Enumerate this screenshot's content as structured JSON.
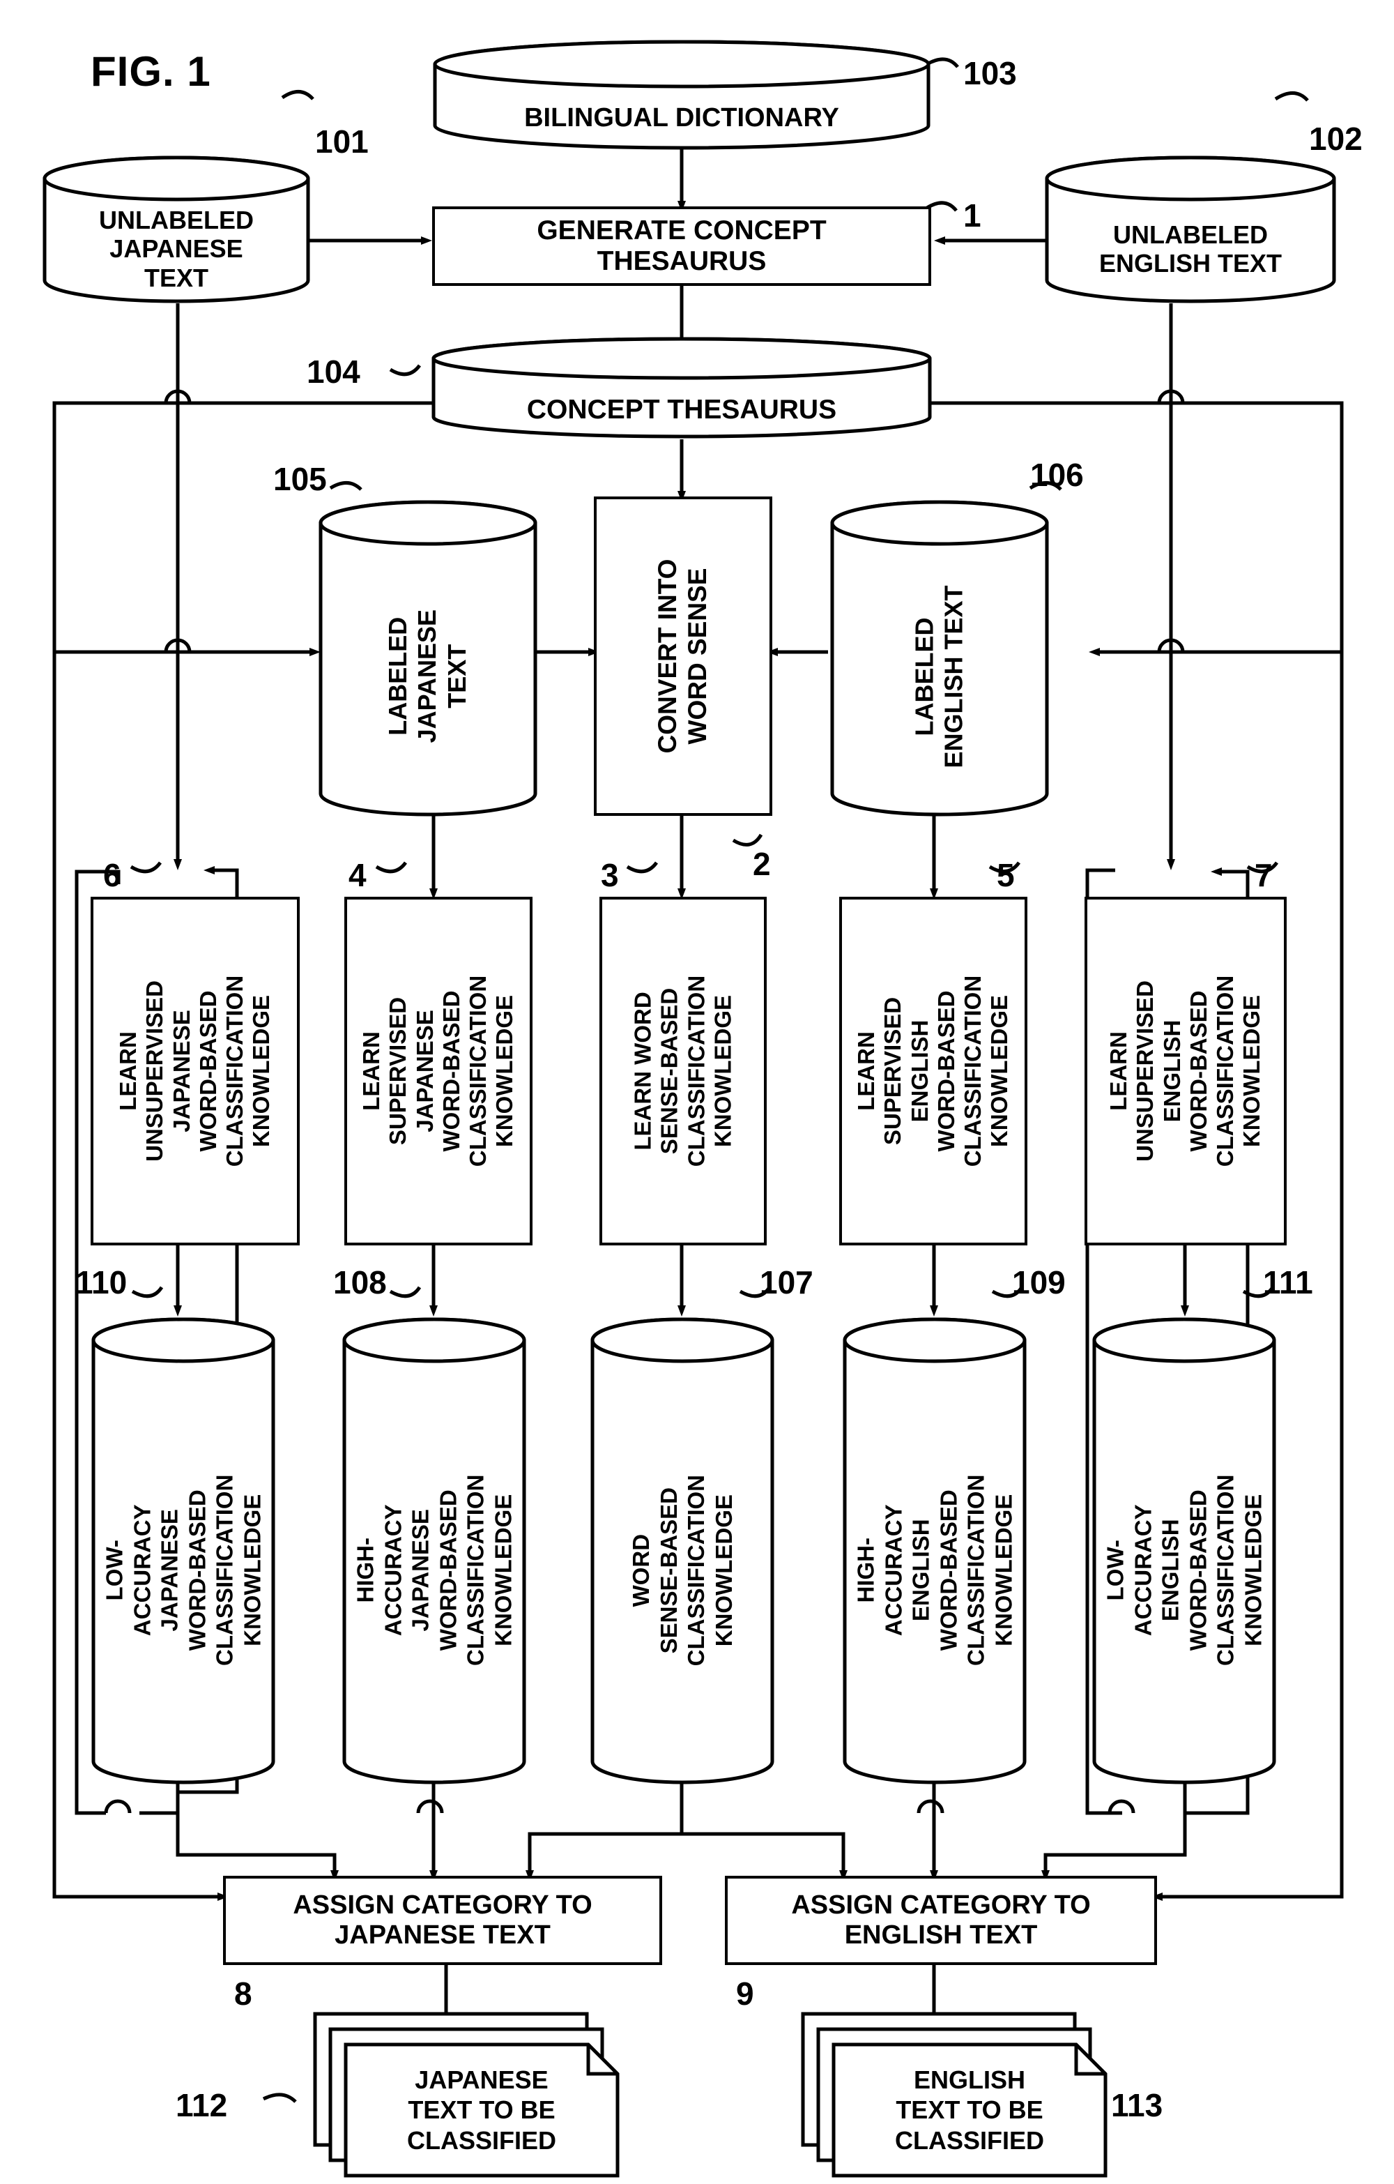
{
  "figure": {
    "title": "FIG. 1"
  },
  "nodes": {
    "bilingual_dictionary": {
      "label": "BILINGUAL DICTIONARY",
      "ref": "103"
    },
    "unlabeled_japanese_text": {
      "label": "UNLABELED\nJAPANESE\nTEXT",
      "ref": "101"
    },
    "unlabeled_english_text": {
      "label": "UNLABELED\nENGLISH TEXT",
      "ref": "102"
    },
    "generate_concept_thesaurus": {
      "label": "GENERATE CONCEPT\nTHESAURUS",
      "ref": "1"
    },
    "concept_thesaurus": {
      "label": "CONCEPT THESAURUS",
      "ref": "104"
    },
    "labeled_japanese_text": {
      "label": "LABELED\nJAPANESE\nTEXT",
      "ref": "105"
    },
    "labeled_english_text": {
      "label": "LABELED\nENGLISH TEXT",
      "ref": "106"
    },
    "convert_into_word_sense": {
      "label": "CONVERT INTO\nWORD SENSE",
      "ref": "2"
    },
    "learn_unsupervised_japanese": {
      "label": "LEARN\nUNSUPERVISED\nJAPANESE\nWORD-BASED\nCLASSIFICATION\nKNOWLEDGE",
      "ref": "6"
    },
    "learn_supervised_japanese": {
      "label": "LEARN\nSUPERVISED\nJAPANESE\nWORD-BASED\nCLASSIFICATION\nKNOWLEDGE",
      "ref": "4"
    },
    "learn_word_sense_based": {
      "label": "LEARN WORD\nSENSE-BASED\nCLASSIFICATION\nKNOWLEDGE",
      "ref": "3"
    },
    "learn_supervised_english": {
      "label": "LEARN\nSUPERVISED\nENGLISH\nWORD-BASED\nCLASSIFICATION\nKNOWLEDGE",
      "ref": "5"
    },
    "learn_unsupervised_english": {
      "label": "LEARN\nUNSUPERVISED\nENGLISH\nWORD-BASED\nCLASSIFICATION\nKNOWLEDGE",
      "ref": "7"
    },
    "low_accuracy_japanese": {
      "label": "LOW-ACCURACY\nJAPANESE\nWORD-BASED\nCLASSIFICATION\nKNOWLEDGE",
      "ref": "110"
    },
    "high_accuracy_japanese": {
      "label": "HIGH-ACCURACY\nJAPANESE\nWORD-BASED\nCLASSIFICATION\nKNOWLEDGE",
      "ref": "108"
    },
    "word_sense_based_knowledge": {
      "label": "WORD\nSENSE-BASED\nCLASSIFICATION\nKNOWLEDGE",
      "ref": "107"
    },
    "high_accuracy_english": {
      "label": "HIGH-ACCURACY\nENGLISH\nWORD-BASED\nCLASSIFICATION\nKNOWLEDGE",
      "ref": "109"
    },
    "low_accuracy_english": {
      "label": "LOW-ACCURACY\nENGLISH\nWORD-BASED\nCLASSIFICATION\nKNOWLEDGE",
      "ref": "111"
    },
    "assign_category_japanese": {
      "label": "ASSIGN CATEGORY TO\nJAPANESE TEXT",
      "ref": "8"
    },
    "assign_category_english": {
      "label": "ASSIGN CATEGORY TO\nENGLISH TEXT",
      "ref": "9"
    },
    "japanese_text_to_be_classified": {
      "label": "JAPANESE\nTEXT TO BE\nCLASSIFIED",
      "ref": "112"
    },
    "english_text_to_be_classified": {
      "label": "ENGLISH\nTEXT TO BE\nCLASSIFIED",
      "ref": "113"
    }
  },
  "colors": {
    "line": "#000000",
    "background": "#ffffff"
  }
}
